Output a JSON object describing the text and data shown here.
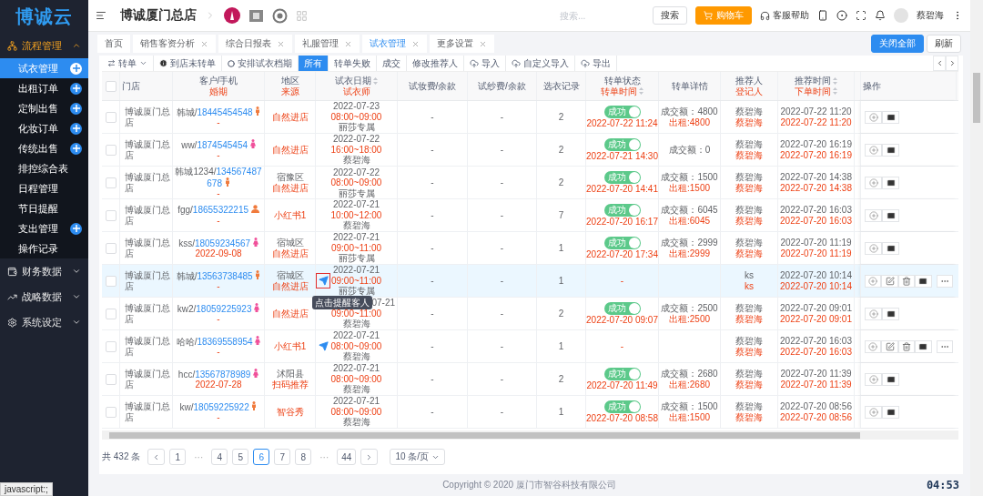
{
  "sidebar": {
    "logo": "博诚云",
    "groups": [
      {
        "label": "流程管理",
        "expanded": true,
        "items": [
          {
            "label": "试衣管理",
            "selected": true,
            "addable": true
          },
          {
            "label": "出租订单",
            "selected": false,
            "addable": true
          },
          {
            "label": "定制出售",
            "selected": false,
            "addable": true
          },
          {
            "label": "化妆订单",
            "selected": false,
            "addable": true
          },
          {
            "label": "传统出售",
            "selected": false,
            "addable": true
          },
          {
            "label": "排控综合表",
            "selected": false,
            "addable": false
          },
          {
            "label": "日程管理",
            "selected": false,
            "addable": false
          },
          {
            "label": "节日提醒",
            "selected": false,
            "addable": false
          },
          {
            "label": "支出管理",
            "selected": false,
            "addable": true
          },
          {
            "label": "操作记录",
            "selected": false,
            "addable": false
          }
        ]
      },
      {
        "label": "财务数据",
        "expanded": false
      },
      {
        "label": "战略数据",
        "expanded": false
      },
      {
        "label": "系统设定",
        "expanded": false
      }
    ]
  },
  "header": {
    "store": "博诚厦门总店",
    "search": {
      "placeholder": "搜索..."
    },
    "search_button": "搜索",
    "cart_button": "购物车",
    "help": "客服帮助",
    "user": "蔡碧海"
  },
  "tabs": [
    {
      "label": "首页",
      "closable": false,
      "selected": false
    },
    {
      "label": "销售客资分析",
      "closable": true,
      "selected": false
    },
    {
      "label": "综合日报表",
      "closable": true,
      "selected": false
    },
    {
      "label": "礼服管理",
      "closable": true,
      "selected": false
    },
    {
      "label": "试衣管理",
      "closable": true,
      "selected": true
    },
    {
      "label": "更多设置",
      "closable": true,
      "selected": false
    }
  ],
  "tab_actions": [
    {
      "label": "关闭全部",
      "kind": "primary"
    },
    {
      "label": "刷新",
      "kind": "plain"
    }
  ],
  "toolbar": [
    {
      "label": "转单",
      "kind": "dropdown",
      "selected": false
    },
    {
      "label": "到店未转单",
      "kind": "button",
      "selected": false
    },
    {
      "label": "安排试衣档期",
      "kind": "button",
      "selected": false
    },
    {
      "label": "所有",
      "kind": "filter",
      "selected": true
    },
    {
      "label": "转单失败",
      "kind": "filter",
      "selected": false
    },
    {
      "label": "成交",
      "kind": "filter",
      "selected": false
    },
    {
      "label": "修改推荐人",
      "kind": "button",
      "selected": false
    },
    {
      "label": "导入",
      "kind": "upload",
      "selected": false
    },
    {
      "label": "自定义导入",
      "kind": "upload",
      "selected": false
    },
    {
      "label": "导出",
      "kind": "upload",
      "selected": false
    }
  ],
  "table": {
    "all_checked": false,
    "columns": [
      {
        "label": "门店"
      },
      {
        "label": "客户/手机",
        "sublabel": "婚期"
      },
      {
        "label": "地区",
        "sublabel": "来源"
      },
      {
        "label": "试衣日期",
        "sortable": true,
        "sublabel": "试衣师"
      },
      {
        "label": "试妆费/余款"
      },
      {
        "label": "试纱费/余款"
      },
      {
        "label": "选衣记录"
      },
      {
        "label": "转单状态",
        "sublabel": "转单时间",
        "sub_sortable": true
      },
      {
        "label": "转单详情"
      },
      {
        "label": "推荐人",
        "sublabel": "登记人"
      },
      {
        "label": "推荐时间",
        "sortable": true,
        "sublabel": "下单时间",
        "sub_sortable": true
      },
      {
        "label": "操作"
      }
    ],
    "rows": [
      {
        "checked": false,
        "hovered": false,
        "store": "博诚厦门总店",
        "name": "韩城/",
        "phone": "18445454548",
        "badge": {
          "kind": "male"
        },
        "wedding": "-",
        "region": "",
        "source": "自然进店",
        "date": "2022-07-23",
        "time": "08:00~09:00",
        "fitter": "丽莎专属",
        "fee1": "-",
        "fee2": "-",
        "picks": "2",
        "status": {
          "on": true,
          "label": "成功"
        },
        "status_time": "2022-07-22 11:24",
        "deal": "成交额：4800",
        "rent": "出租:4800",
        "recommender": "蔡碧海",
        "registrar": "蔡碧海",
        "rec_time": "2022-07-22 11:20",
        "order_time": "2022-07-22 11:20",
        "actions": [
          {
            "kind": "add"
          },
          {
            "kind": "mail"
          }
        ]
      },
      {
        "checked": false,
        "hovered": false,
        "store": "博诚厦门总店",
        "name": "ww/",
        "phone": "1874545454",
        "badge": {
          "kind": "female"
        },
        "wedding": "-",
        "region": "",
        "source": "自然进店",
        "date": "2022-07-22",
        "time": "16:00~18:00",
        "fitter": "蔡碧海",
        "fee1": "-",
        "fee2": "-",
        "picks": "2",
        "status": {
          "on": true,
          "label": "成功"
        },
        "status_time": "2022-07-21 14:30",
        "deal": "成交额：0",
        "rent": "",
        "recommender": "蔡碧海",
        "registrar": "蔡碧海",
        "rec_time": "2022-07-20 16:19",
        "order_time": "2022-07-20 16:19",
        "actions": [
          {
            "kind": "add"
          },
          {
            "kind": "mail"
          }
        ]
      },
      {
        "checked": false,
        "hovered": false,
        "store": "博诚厦门总店",
        "name": "韩城1234/",
        "phone": "134567487678",
        "badge": {
          "kind": "male"
        },
        "wedding": "-",
        "region": "宿豫区",
        "source": "自然进店",
        "date": "2022-07-22",
        "time": "08:00~09:00",
        "fitter": "丽莎专属",
        "fee1": "-",
        "fee2": "-",
        "picks": "2",
        "status": {
          "on": true,
          "label": "成功"
        },
        "status_time": "2022-07-20 14:41",
        "deal": "成交额：1500",
        "rent": "出租:1500",
        "recommender": "蔡碧海",
        "registrar": "蔡碧海",
        "rec_time": "2022-07-20 14:38",
        "order_time": "2022-07-20 14:38",
        "actions": [
          {
            "kind": "add"
          },
          {
            "kind": "mail"
          }
        ]
      },
      {
        "checked": false,
        "hovered": false,
        "store": "博诚厦门总店",
        "name": "fgg/",
        "phone": "18655322215",
        "badge": {
          "kind": "person"
        },
        "wedding": "-",
        "region": "",
        "source": "小红书1",
        "date": "2022-07-21",
        "time": "10:00~12:00",
        "fitter": "蔡碧海",
        "fee1": "-",
        "fee2": "-",
        "picks": "7",
        "status": {
          "on": true,
          "label": "成功"
        },
        "status_time": "2022-07-20 16:17",
        "deal": "成交额：6045",
        "rent": "出租:6045",
        "recommender": "蔡碧海",
        "registrar": "蔡碧海",
        "rec_time": "2022-07-20 16:03",
        "order_time": "2022-07-20 16:03",
        "actions": [
          {
            "kind": "add"
          },
          {
            "kind": "mail"
          }
        ]
      },
      {
        "checked": false,
        "hovered": false,
        "store": "博诚厦门总店",
        "name": "kss/",
        "phone": "18059234567",
        "badge": {
          "kind": "female"
        },
        "wedding": "2022-09-08",
        "region": "宿城区",
        "source": "自然进店",
        "date": "2022-07-21",
        "time": "09:00~11:00",
        "fitter": "丽莎专属",
        "fee1": "-",
        "fee2": "-",
        "picks": "1",
        "status": {
          "on": true,
          "label": "成功"
        },
        "status_time": "2022-07-20 17:34",
        "deal": "成交额：2999",
        "rent": "出租:2999",
        "recommender": "蔡碧海",
        "registrar": "蔡碧海",
        "rec_time": "2022-07-20 11:19",
        "order_time": "2022-07-20 11:19",
        "actions": [
          {
            "kind": "add"
          },
          {
            "kind": "mail"
          }
        ]
      },
      {
        "checked": false,
        "hovered": true,
        "store": "博诚厦门总店",
        "name": "韩城/",
        "phone": "13563738485",
        "badge": {
          "kind": "male"
        },
        "wedding": "-",
        "region": "宿城区",
        "source": "自然进店",
        "date": "2022-07-21",
        "time": "09:00~11:00",
        "fitter": "丽莎专属",
        "remind": {
          "kind": "boxed"
        },
        "tooltip": "点击提醒客人",
        "fee1": "-",
        "fee2": "-",
        "picks": "1",
        "status_time": "-",
        "deal": "",
        "rent": "",
        "recommender": "ks",
        "registrar": "ks",
        "rec_time": "2022-07-20 10:14",
        "order_time": "2022-07-20 10:14",
        "actions": [
          {
            "kind": "add"
          },
          {
            "kind": "edit"
          },
          {
            "kind": "delete"
          },
          {
            "kind": "mail"
          },
          {
            "kind": "more"
          }
        ]
      },
      {
        "checked": false,
        "hovered": false,
        "covered": true,
        "store": "博诚厦门总店",
        "name": "kw2/",
        "phone": "18059225923",
        "badge": {
          "kind": "female"
        },
        "wedding": "-",
        "region": "",
        "source": "自然进店",
        "date": "07-21",
        "time": "09:00~11:00",
        "fitter": "蔡碧海",
        "fee1": "-",
        "fee2": "-",
        "picks": "2",
        "status": {
          "on": true,
          "label": "成功"
        },
        "status_time": "2022-07-20 09:07",
        "deal": "成交额：2500",
        "rent": "出租:2500",
        "recommender": "蔡碧海",
        "registrar": "蔡碧海",
        "rec_time": "2022-07-20 09:01",
        "order_time": "2022-07-20 09:01",
        "actions": [
          {
            "kind": "add"
          },
          {
            "kind": "mail"
          }
        ]
      },
      {
        "checked": false,
        "hovered": false,
        "store": "博诚厦门总店",
        "name": "哈哈/",
        "phone": "18369558954",
        "badge": {
          "kind": "female"
        },
        "wedding": "-",
        "region": "",
        "source": "小红书1",
        "date": "2022-07-21",
        "time": "08:00~09:00",
        "fitter": "蔡碧海",
        "remind": {
          "kind": "plain"
        },
        "fee1": "-",
        "fee2": "-",
        "picks": "1",
        "status_time": "-",
        "deal": "",
        "rent": "",
        "recommender": "蔡碧海",
        "registrar": "蔡碧海",
        "rec_time": "2022-07-20 16:03",
        "order_time": "2022-07-20 16:03",
        "actions": [
          {
            "kind": "add"
          },
          {
            "kind": "edit"
          },
          {
            "kind": "delete"
          },
          {
            "kind": "mail"
          },
          {
            "kind": "more"
          }
        ]
      },
      {
        "checked": false,
        "hovered": false,
        "store": "博诚厦门总店",
        "name": "hcc/",
        "phone": "13567878989",
        "badge": {
          "kind": "female"
        },
        "wedding": "2022-07-28",
        "region": "沭阳县",
        "source": "扫码推荐",
        "date": "2022-07-21",
        "time": "08:00~09:00",
        "fitter": "蔡碧海",
        "fee1": "-",
        "fee2": "-",
        "picks": "2",
        "status": {
          "on": true,
          "label": "成功"
        },
        "status_time": "2022-07-20 11:49",
        "deal": "成交额：2680",
        "rent": "出租:2680",
        "recommender": "蔡碧海",
        "registrar": "蔡碧海",
        "rec_time": "2022-07-20 11:39",
        "order_time": "2022-07-20 11:39",
        "actions": [
          {
            "kind": "add"
          },
          {
            "kind": "mail"
          }
        ]
      },
      {
        "checked": false,
        "hovered": false,
        "store": "博诚厦门总店",
        "name": "kw/",
        "phone": "18059225922",
        "badge": {
          "kind": "male"
        },
        "wedding": "-",
        "region": "",
        "source": "智谷秀",
        "date": "2022-07-21",
        "time": "08:00~09:00",
        "fitter": "蔡碧海",
        "fee1": "-",
        "fee2": "-",
        "picks": "1",
        "status": {
          "on": true,
          "label": "成功"
        },
        "status_time": "2022-07-20 08:58",
        "deal": "成交额：1500",
        "rent": "出租:1500",
        "recommender": "蔡碧海",
        "registrar": "蔡碧海",
        "rec_time": "2022-07-20 08:56",
        "order_time": "2022-07-20 08:56",
        "actions": [
          {
            "kind": "add"
          },
          {
            "kind": "mail"
          }
        ]
      }
    ]
  },
  "pagination": {
    "total": "共 432 条",
    "pages": [
      {
        "label": "1",
        "kind": "page",
        "selected": false
      },
      {
        "label": "···",
        "kind": "gap"
      },
      {
        "label": "4",
        "kind": "page",
        "selected": false
      },
      {
        "label": "5",
        "kind": "page",
        "selected": false
      },
      {
        "label": "6",
        "kind": "page",
        "selected": true
      },
      {
        "label": "7",
        "kind": "page",
        "selected": false
      },
      {
        "label": "8",
        "kind": "page",
        "selected": false
      },
      {
        "label": "···",
        "kind": "gap"
      },
      {
        "label": "44",
        "kind": "page",
        "selected": false
      }
    ],
    "page_size": "10 条/页"
  },
  "footer": "Copyright © 2020 厦门市智谷科技有限公司",
  "status_url": "javascript:;",
  "timer": "04:53"
}
